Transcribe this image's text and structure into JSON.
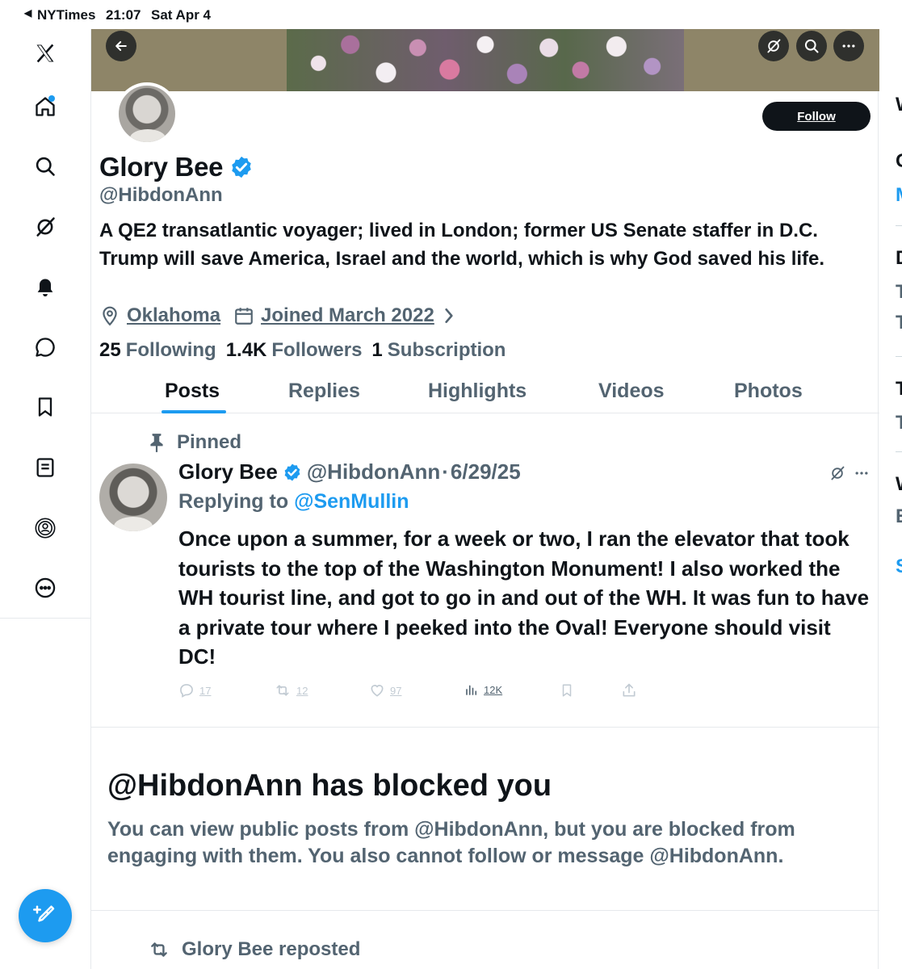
{
  "status_bar": {
    "back_arrow": "◀",
    "app": "NYTimes",
    "time": "21:07",
    "date": "Sat Apr 4"
  },
  "nav": {
    "items": [
      "x-logo-icon",
      "home-icon",
      "search-icon",
      "grok-icon",
      "notifications-icon",
      "messages-icon",
      "bookmarks-icon",
      "lists-icon",
      "profile-icon",
      "more-icon"
    ],
    "compose_icon": "compose-icon"
  },
  "profile": {
    "name": "Glory Bee",
    "handle": "@HibdonAnn",
    "bio": "A QE2 transatlantic voyager; lived in London; former US Senate staffer in D.C. Trump will save America, Israel and the world, which is why God saved his life.",
    "location": "Oklahoma",
    "joined": "Joined March 2022",
    "following_count": "25",
    "following_label": "Following",
    "followers_count": "1.4K",
    "followers_label": "Followers",
    "subscription_count": "1",
    "subscription_label": "Subscription",
    "follow_button": "Follow"
  },
  "tabs": [
    "Posts",
    "Replies",
    "Highlights",
    "Videos",
    "Photos"
  ],
  "active_tab": "Posts",
  "pinned_post": {
    "pinned_label": "Pinned",
    "author": "Glory Bee",
    "handle": "@HibdonAnn",
    "separator": "·",
    "date": "6/29/25",
    "replying_prefix": "Replying to",
    "replying_to": "@SenMullin",
    "text": "Once upon a summer, for a week or two, I ran the elevator that took tourists to the top of the Washington Monument!  I also worked the WH tourist line, and got to go in and out of the WH.  It was fun to have a private tour where I peeked into the Oval!  Everyone should visit DC!",
    "replies": "17",
    "reposts": "12",
    "likes": "97",
    "views": "12K"
  },
  "blocked_notice": {
    "title": "@HibdonAnn has blocked you",
    "description": "You can view public posts from @HibdonAnn, but you are blocked from engaging with them. You also cannot follow or message @HibdonAnn."
  },
  "repost_label": "Glory Bee reposted",
  "colors": {
    "accent": "#1d9bf0",
    "text_primary": "#0f1419",
    "text_secondary": "#536471",
    "follow_bg": "#0f1419",
    "banner_bg": "#8e8568"
  }
}
